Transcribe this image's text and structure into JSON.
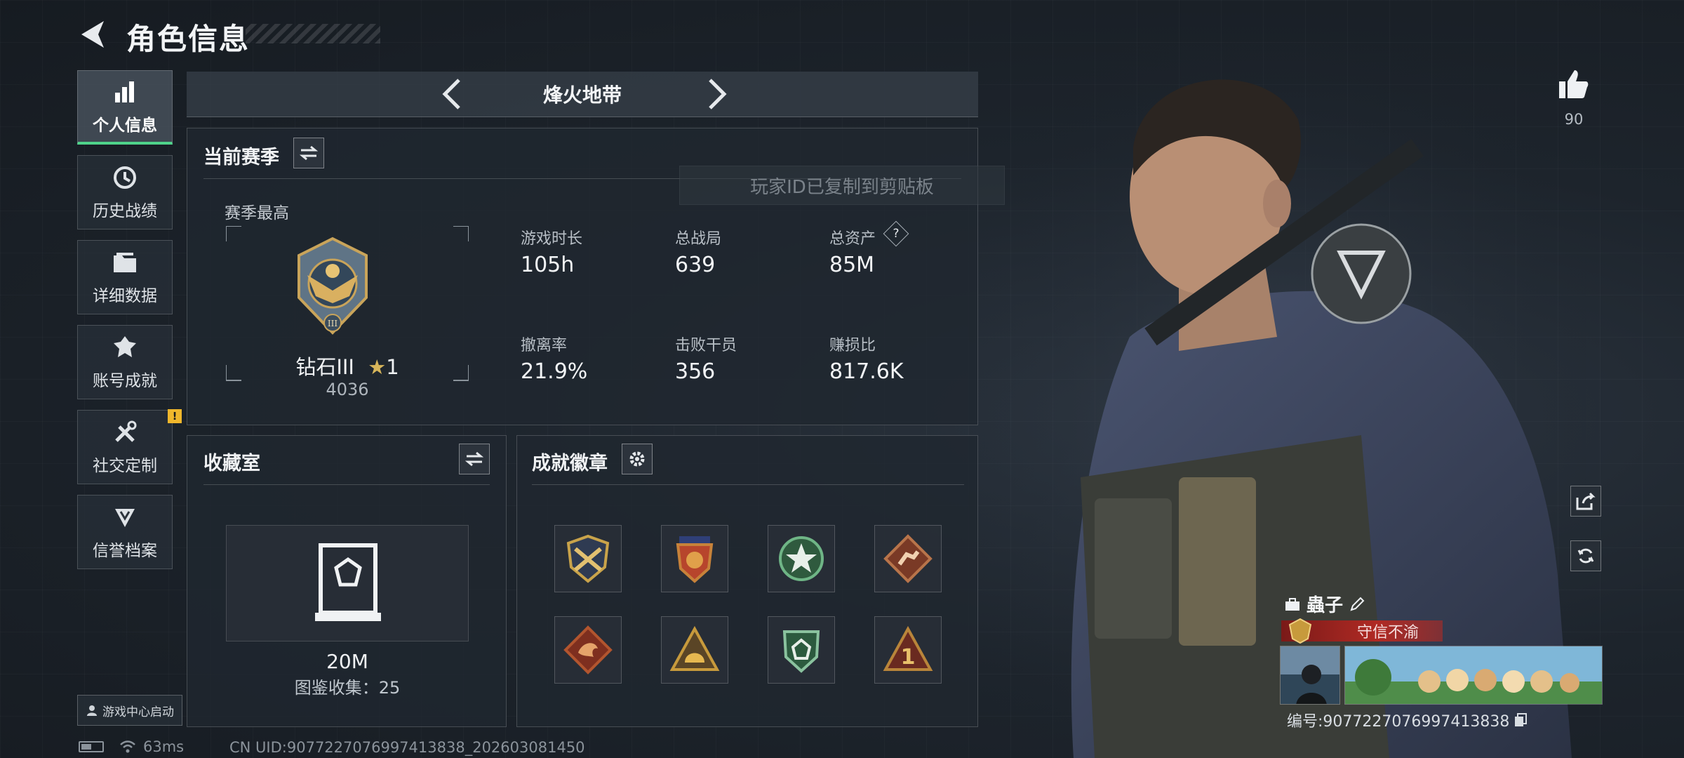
{
  "header": {
    "title": "角色信息"
  },
  "nav": {
    "items": [
      {
        "label": "个人信息",
        "icon": "bar-chart-icon",
        "active": true
      },
      {
        "label": "历史战绩",
        "icon": "history-clock-icon"
      },
      {
        "label": "详细数据",
        "icon": "folder-icon"
      },
      {
        "label": "账号成就",
        "icon": "achievement-icon"
      },
      {
        "label": "社交定制",
        "icon": "tools-icon",
        "badge": "!"
      },
      {
        "label": "信誉档案",
        "icon": "credit-shield-icon"
      }
    ]
  },
  "launch_button": {
    "label": "游戏中心启动"
  },
  "status": {
    "ping": "63ms",
    "uid": "CN UID:9077227076997413838_202603081450"
  },
  "mode": {
    "title": "烽火地带"
  },
  "season": {
    "title": "当前赛季",
    "best_label": "赛季最高",
    "rank_name": "钻石III",
    "rank_stars": "1",
    "rank_score": "4036",
    "stats": [
      {
        "label": "游戏时长",
        "value": "105h"
      },
      {
        "label": "总战局",
        "value": "639"
      },
      {
        "label": "总资产",
        "value": "85M",
        "help": "?"
      },
      {
        "label": "撤离率",
        "value": "21.9%"
      },
      {
        "label": "击败干员",
        "value": "356"
      },
      {
        "label": "赚损比",
        "value": "817.6K"
      }
    ]
  },
  "toast": {
    "text": "玩家ID已复制到剪贴板"
  },
  "collection": {
    "title": "收藏室",
    "value": "20M",
    "catalog": "图鉴收集：25"
  },
  "badges": {
    "title": "成就徽章",
    "items": [
      {
        "icon": "crossed-swords-badge-icon",
        "color": "#c9a34a"
      },
      {
        "icon": "star-shield-badge-icon",
        "color": "#c7823a"
      },
      {
        "icon": "green-star-badge-icon",
        "color": "#3f8a5a"
      },
      {
        "icon": "runner-diamond-badge-icon",
        "color": "#b8744a"
      },
      {
        "icon": "dragon-diamond-badge-icon",
        "color": "#b2552e"
      },
      {
        "icon": "helmet-triangle-badge-icon",
        "color": "#c79a3c"
      },
      {
        "icon": "green-shield-badge-icon",
        "color": "#3c8a58"
      },
      {
        "icon": "number-one-triangle-badge-icon",
        "color": "#b9853a"
      }
    ]
  },
  "profile": {
    "likes": "90",
    "name": "蟲子",
    "title_text": "守信不渝",
    "id_text": "编号:9077227076997413838"
  },
  "colors": {
    "accent_green": "#4fd38a",
    "badge_yellow": "#f0b72c",
    "title_red": "#b02a24"
  }
}
